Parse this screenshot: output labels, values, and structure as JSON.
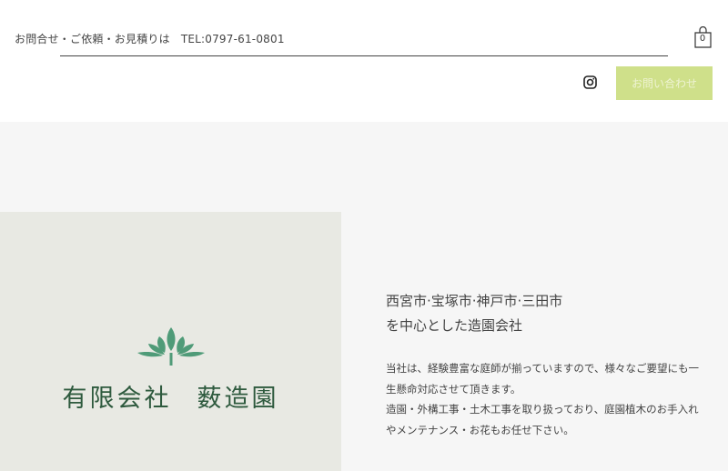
{
  "header": {
    "contact_text": "お問合せ・ご依頼・お見積りは",
    "tel": "TEL:0797-61-0801",
    "cart_count": "0",
    "contact_button": "お問い合わせ",
    "accent_color": "#cfe08a"
  },
  "icons": {
    "cart": "shopping-bag-icon",
    "social": "instagram-icon",
    "logo": "lotus-leaf-logo-icon"
  },
  "brand": {
    "company_prefix": "有限会社",
    "company_name": "薮造園",
    "brand_color": "#2e5a3e"
  },
  "intro": {
    "tagline_line1": "西宮市·宝塚市·神戸市·三田市",
    "tagline_line2": "を中心とした造園会社",
    "body_line1": "当社は、経験豊富な庭師が揃っていますので、様々なご要望にも一",
    "body_line2": "生懸命対応させて頂きます。",
    "body_line3": "造園・外構工事・土木工事を取り扱っており、庭園植木のお手入れ",
    "body_line4": "やメンテナンス・お花もお任せ下さい。"
  }
}
